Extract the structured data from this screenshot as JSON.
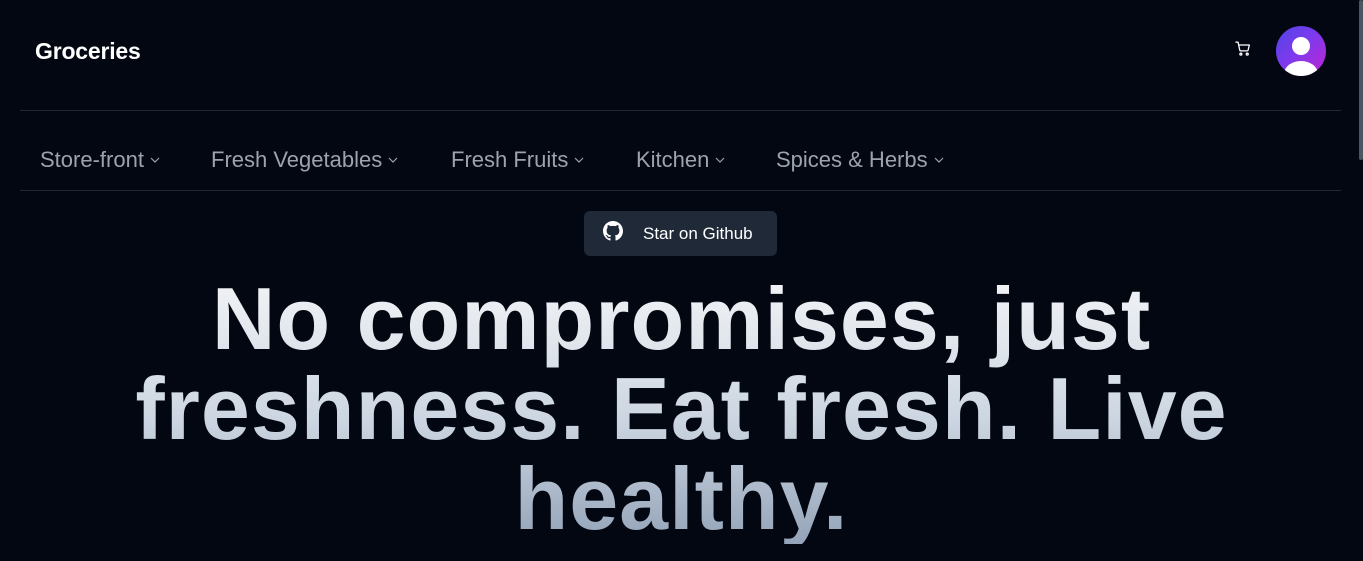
{
  "header": {
    "brand": "Groceries",
    "cart_icon": "shopping-cart-icon",
    "avatar_icon": "user-avatar-icon"
  },
  "nav": {
    "items": [
      {
        "label": "Store-front"
      },
      {
        "label": "Fresh Vegetables"
      },
      {
        "label": "Fresh Fruits"
      },
      {
        "label": "Kitchen"
      },
      {
        "label": "Spices & Herbs"
      }
    ],
    "chevron_icon": "chevron-down-icon"
  },
  "github": {
    "label": "Star on Github",
    "icon": "github-icon"
  },
  "hero": {
    "headline": "No compromises, just freshness. Eat fresh. Live healthy."
  },
  "colors": {
    "background": "#030712",
    "nav_text": "#9ca3af",
    "button_bg": "#1f2937",
    "avatar_gradient": [
      "#4f46e5",
      "#c026d3"
    ]
  }
}
